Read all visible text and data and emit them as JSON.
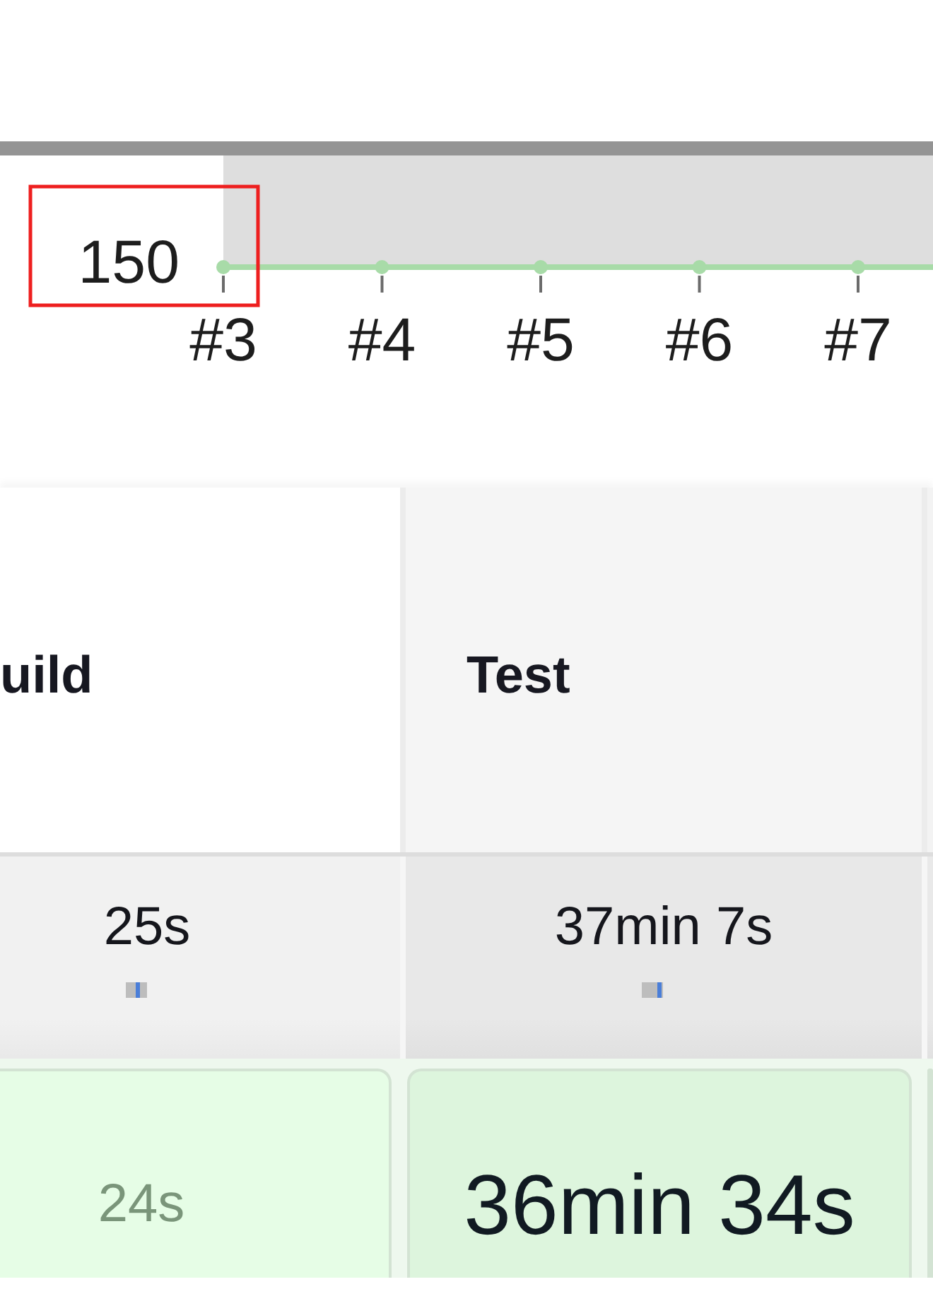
{
  "chart": {
    "y_tick_label": "150",
    "x_labels": [
      "#3",
      "#4",
      "#5",
      "#6",
      "#7"
    ]
  },
  "stages": [
    {
      "name": "uild",
      "selected": false,
      "average": {
        "time": "25s",
        "level": 0.55
      },
      "latest_time": "24s"
    },
    {
      "name": "Test",
      "selected": true,
      "average": {
        "time": "37min 7s",
        "level": 0.8
      },
      "latest_time": "36min 34s"
    }
  ]
}
